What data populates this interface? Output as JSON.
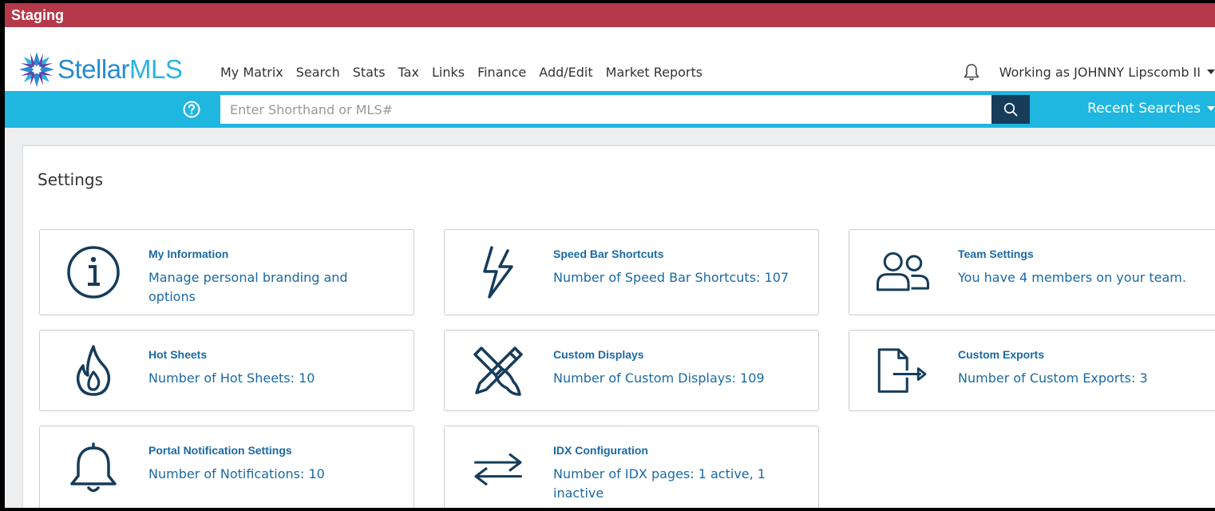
{
  "environment_banner": "Staging",
  "brand": {
    "name_part1": "Stellar",
    "name_part2": "MLS"
  },
  "nav": {
    "items": [
      "My Matrix",
      "Search",
      "Stats",
      "Tax",
      "Links",
      "Finance",
      "Add/Edit",
      "Market Reports"
    ],
    "user_label": "Working as JOHNNY Lipscomb II"
  },
  "search": {
    "placeholder": "Enter Shorthand or MLS#",
    "value": "",
    "recent_label": "Recent Searches"
  },
  "page": {
    "title": "Settings"
  },
  "cards": [
    {
      "icon": "info-icon",
      "title": "My Information",
      "description": "Manage personal branding and options"
    },
    {
      "icon": "lightning-icon",
      "title": "Speed Bar Shortcuts",
      "description": "Number of Speed Bar Shortcuts: 107"
    },
    {
      "icon": "team-icon",
      "title": "Team Settings",
      "description": "You have 4 members on your team."
    },
    {
      "icon": "flame-icon",
      "title": "Hot Sheets",
      "description": "Number of Hot Sheets: 10"
    },
    {
      "icon": "pencil-brush-icon",
      "title": "Custom Displays",
      "description": "Number of Custom Displays: 109"
    },
    {
      "icon": "export-icon",
      "title": "Custom Exports",
      "description": "Number of Custom Exports: 3"
    },
    {
      "icon": "bell-icon",
      "title": "Portal Notification Settings",
      "description": "Number of Notifications: 10"
    },
    {
      "icon": "swap-arrows-icon",
      "title": "IDX Configuration",
      "description": "Number of IDX pages: 1 active, 1 inactive"
    }
  ],
  "colors": {
    "banner": "#b5394a",
    "search_bar": "#1fb6e0",
    "search_button": "#163c5a",
    "link": "#1a6aa2",
    "icon": "#163c5a"
  }
}
